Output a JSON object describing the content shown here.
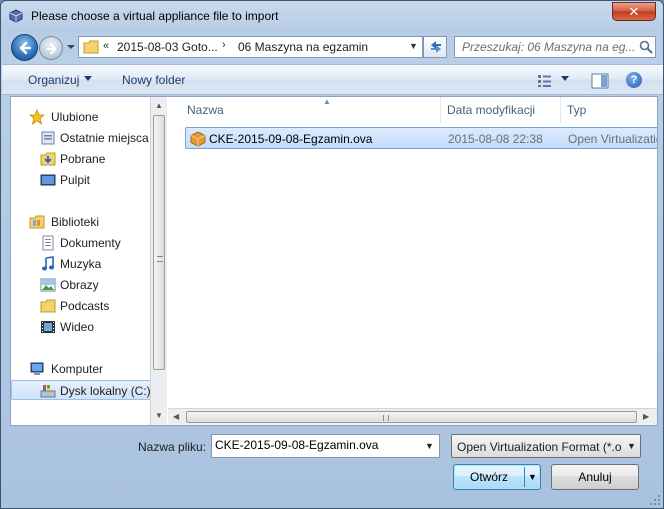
{
  "window": {
    "title": "Please choose a virtual appliance file to import",
    "close_label": "✕"
  },
  "address_bar": {
    "chevron": "«",
    "segments": [
      "2015-08-03 Goto...",
      "06 Maszyna na egzamin"
    ],
    "separator": "›"
  },
  "search": {
    "placeholder": "Przeszukaj: 06 Maszyna na eg..."
  },
  "toolbar": {
    "organize_label": "Organizuj",
    "new_folder_label": "Nowy folder",
    "help_label": "?"
  },
  "nav_pane": {
    "items": [
      {
        "label": "Ulubione",
        "icon": "star-icon"
      },
      {
        "label": "Ostatnie miejsca",
        "icon": "recent-places-icon"
      },
      {
        "label": "Pobrane",
        "icon": "downloads-folder-icon"
      },
      {
        "label": "Pulpit",
        "icon": "desktop-icon"
      },
      {
        "label": "Biblioteki",
        "icon": "libraries-icon"
      },
      {
        "label": "Dokumenty",
        "icon": "documents-icon"
      },
      {
        "label": "Muzyka",
        "icon": "music-icon"
      },
      {
        "label": "Obrazy",
        "icon": "pictures-icon"
      },
      {
        "label": "Podcasts",
        "icon": "folder-icon"
      },
      {
        "label": "Wideo",
        "icon": "video-icon"
      },
      {
        "label": "Komputer",
        "icon": "computer-icon"
      },
      {
        "label": "Dysk lokalny (C:)",
        "icon": "local-disk-icon"
      }
    ]
  },
  "file_list": {
    "columns": [
      "Nazwa",
      "Data modyfikacji",
      "Typ"
    ],
    "rows": [
      {
        "name": "CKE-2015-09-08-Egzamin.ova",
        "date": "2015-08-08 22:38",
        "type": "Open Virtualization"
      }
    ]
  },
  "bottom": {
    "filename_label": "Nazwa pliku:",
    "filename_value": "CKE-2015-09-08-Egzamin.ova",
    "filter_value": "Open Virtualization Format (*.o",
    "open_label": "Otwórz",
    "cancel_label": "Anuluj"
  },
  "colors": {
    "selection": "#c1dcfc",
    "accent": "#1e3b66",
    "close": "#c23a1c"
  }
}
